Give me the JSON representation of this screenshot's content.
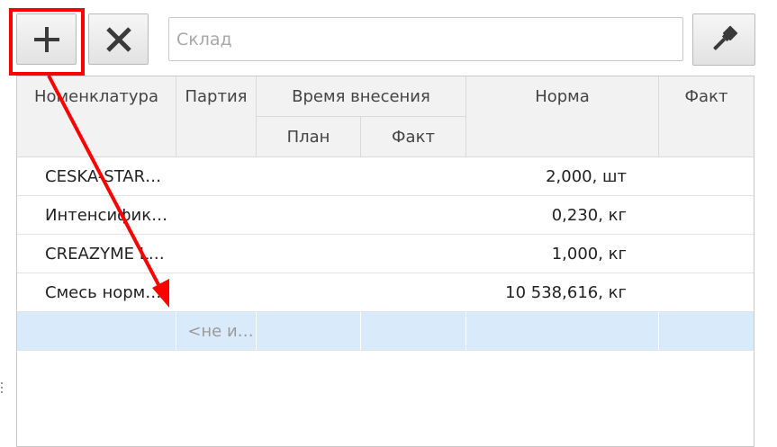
{
  "toolbar": {
    "add_icon": "plus-icon",
    "delete_icon": "close-icon",
    "clear_icon": "paint-brush-icon",
    "warehouse_placeholder": "Склад"
  },
  "table": {
    "headers": {
      "nomenclature": "Номенклатура",
      "batch": "Партия",
      "entry_time": "Время внесения",
      "entry_plan": "План",
      "entry_fact": "Факт",
      "norm": "Норма",
      "fact": "Факт"
    },
    "rows": [
      {
        "name": "CESKA-STAR…",
        "norm": "2,000, шт"
      },
      {
        "name": "Интенсифик…",
        "norm": "0,230, кг"
      },
      {
        "name": "CREAZYME L…",
        "norm": "1,000, кг"
      },
      {
        "name": "Смесь норм…",
        "norm": "10 538,616, кг"
      }
    ],
    "new_row": {
      "batch_placeholder": "<не и…"
    }
  },
  "annotation": {
    "color": "#ff0000"
  }
}
